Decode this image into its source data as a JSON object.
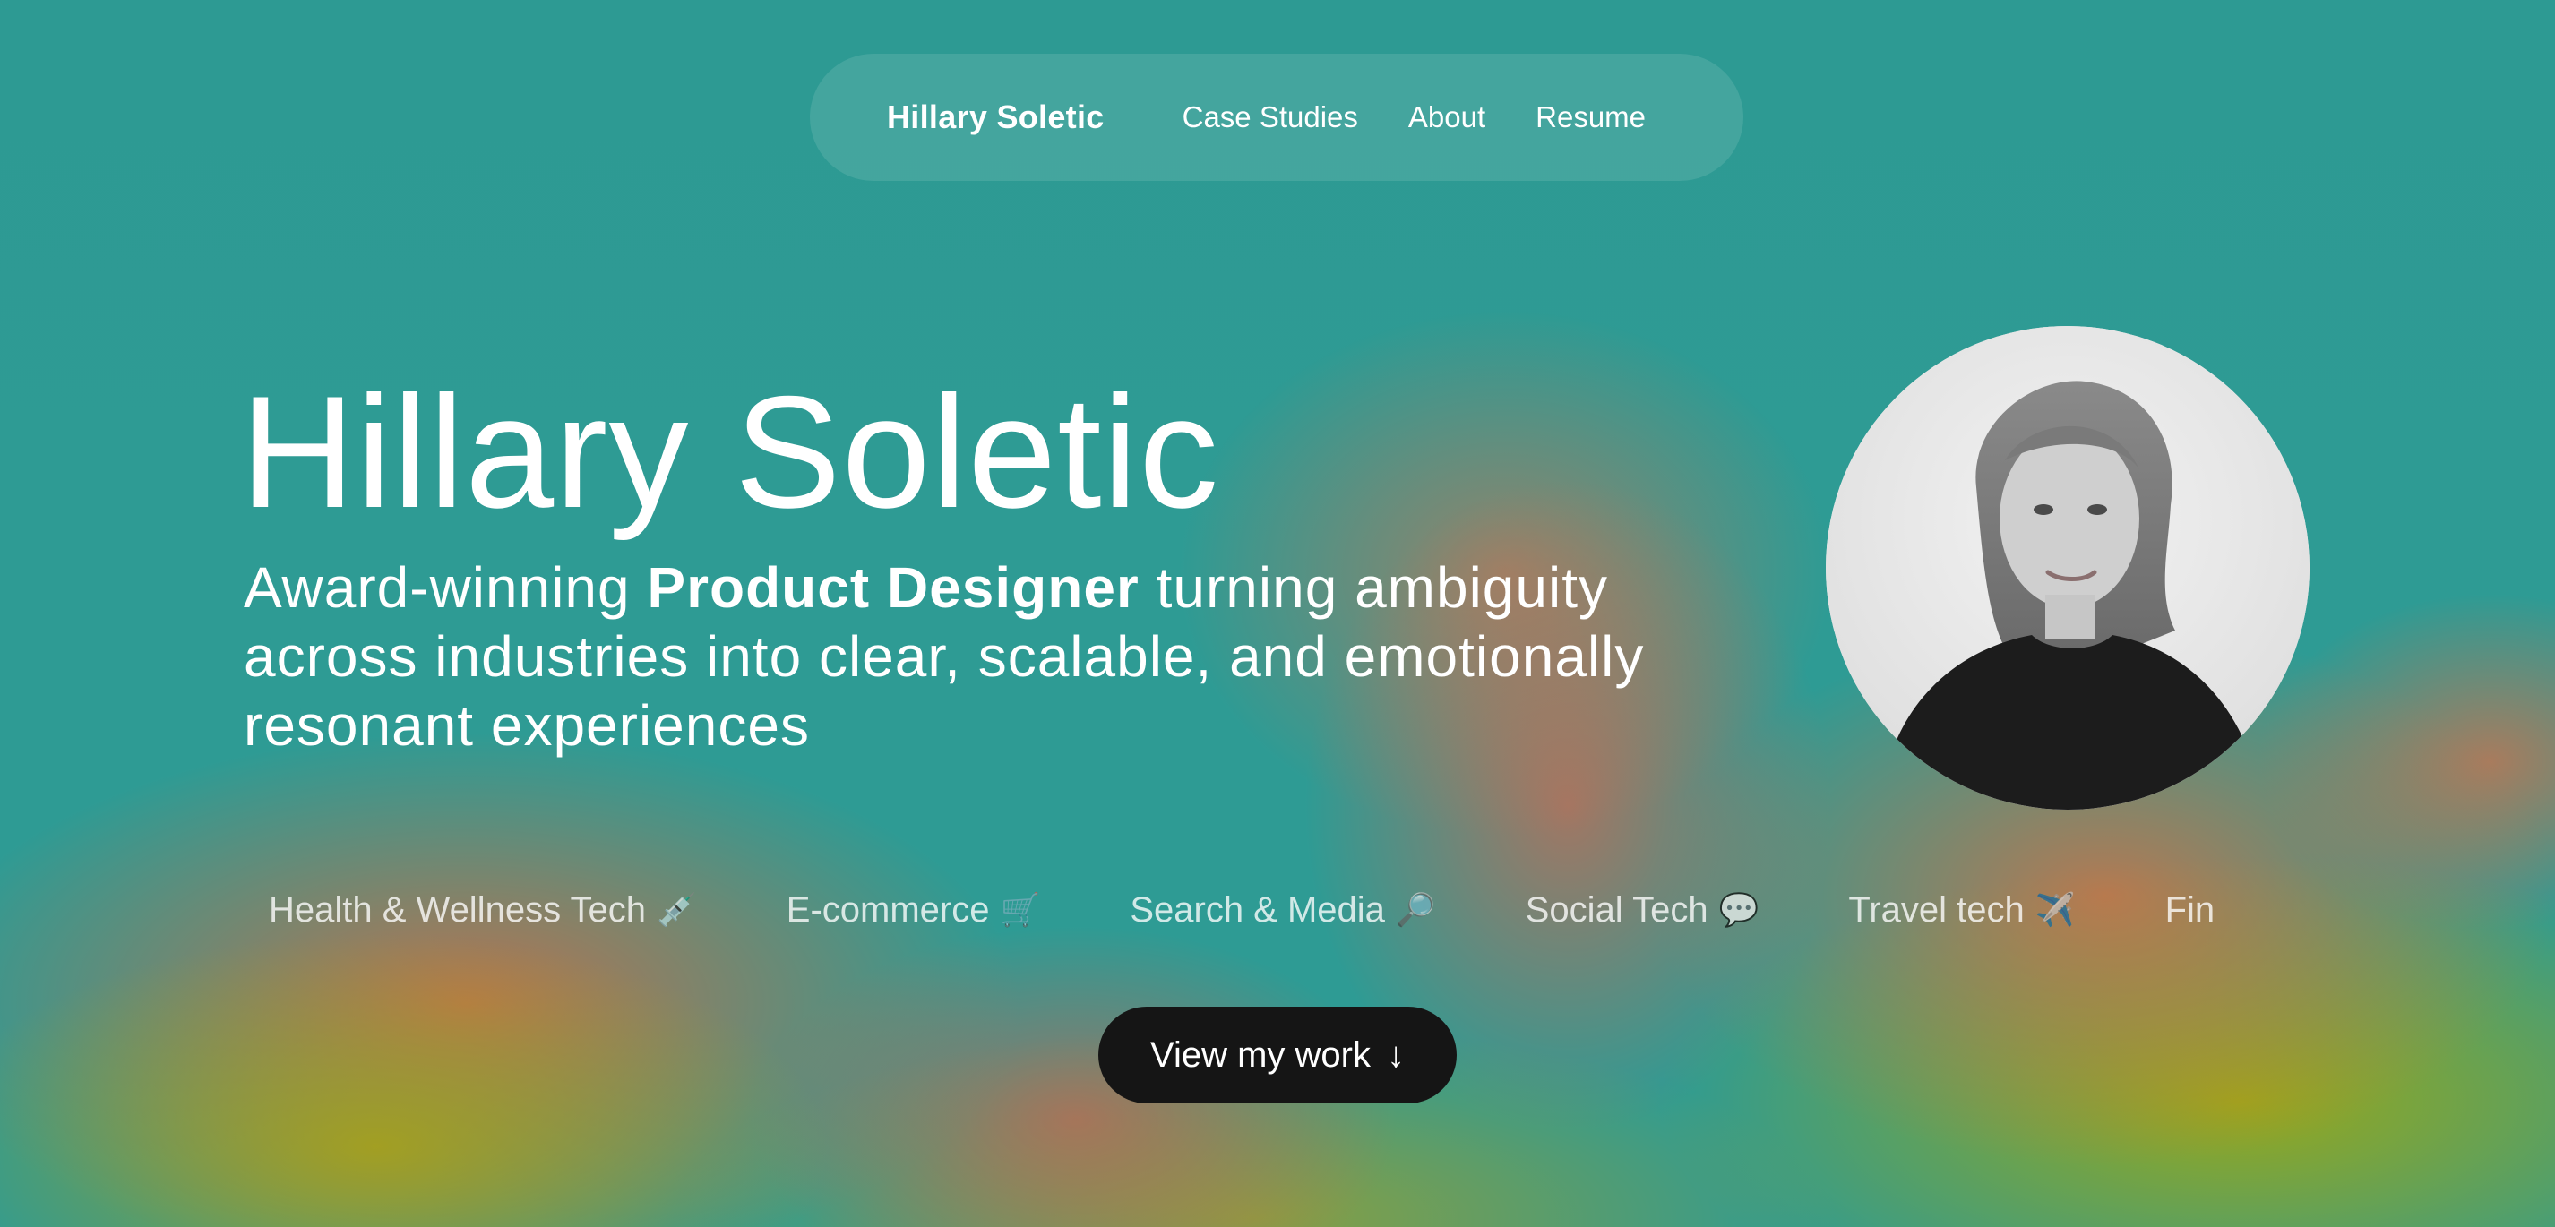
{
  "nav": {
    "brand": "Hillary Soletic",
    "links": [
      "Case Studies",
      "About",
      "Resume"
    ]
  },
  "hero": {
    "title": "Hillary Soletic",
    "subtitle_pre": "Award-winning ",
    "subtitle_bold": "Product Designer",
    "subtitle_post": " turning ambiguity across industries into clear, scalable, and emotionally resonant experiences"
  },
  "industries": [
    {
      "label": "Health & Wellness Tech",
      "emoji": "💉"
    },
    {
      "label": "E-commerce",
      "emoji": "🛒"
    },
    {
      "label": "Search & Media",
      "emoji": "🔎"
    },
    {
      "label": "Social Tech",
      "emoji": "💬"
    },
    {
      "label": "Travel  tech",
      "emoji": "✈️"
    },
    {
      "label": "Fin",
      "emoji": ""
    }
  ],
  "cta": {
    "label": "View my work",
    "arrow": "↓"
  },
  "colors": {
    "background_teal": "#2e9b94",
    "warm_orange": "#e06a44",
    "olive": "#9ea814",
    "button": "#151515"
  },
  "icons": [
    "syringe-icon",
    "cart-icon",
    "magnifier-icon",
    "speech-bubble-icon",
    "airplane-icon",
    "arrow-down-icon"
  ]
}
